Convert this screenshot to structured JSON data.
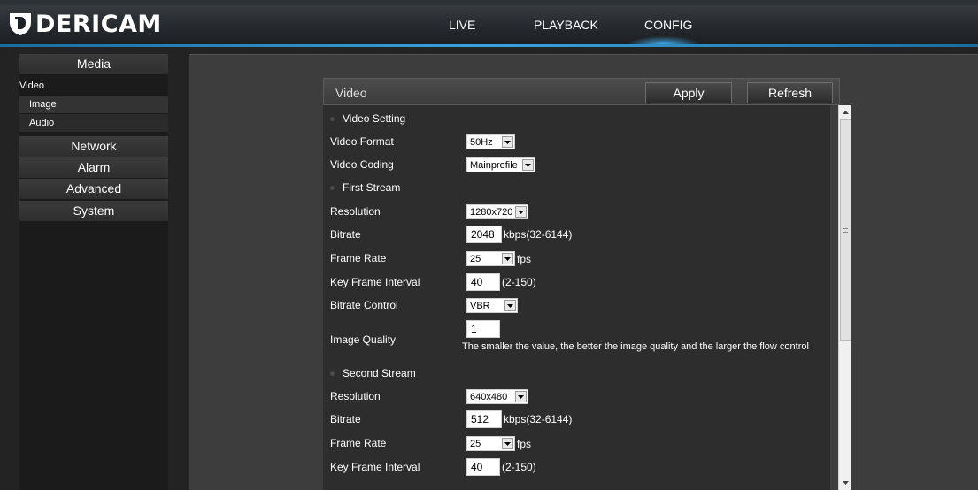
{
  "brand": {
    "name": "DERICAM"
  },
  "nav": {
    "live": "LIVE",
    "playback": "PLAYBACK",
    "config": "CONFIG"
  },
  "sidebar": {
    "media": "Media",
    "video": "Video",
    "image": "Image",
    "audio": "Audio",
    "network": "Network",
    "alarm": "Alarm",
    "advanced": "Advanced",
    "system": "System"
  },
  "panel": {
    "title": "Video",
    "apply": "Apply",
    "refresh": "Refresh"
  },
  "video_setting": {
    "section": "Video Setting",
    "format_label": "Video Format",
    "format_value": "50Hz",
    "coding_label": "Video Coding",
    "coding_value": "Mainprofile"
  },
  "first_stream": {
    "section": "First Stream",
    "resolution_label": "Resolution",
    "resolution_value": "1280x720",
    "bitrate_label": "Bitrate",
    "bitrate_value": "2048",
    "bitrate_unit": "kbps(32-6144)",
    "framerate_label": "Frame Rate",
    "framerate_value": "25",
    "framerate_unit": "fps",
    "keyframe_label": "Key Frame Interval",
    "keyframe_value": "40",
    "keyframe_unit": "(2-150)",
    "bitrate_control_label": "Bitrate Control",
    "bitrate_control_value": "VBR",
    "quality_label": "Image Quality",
    "quality_value": "1",
    "quality_hint": "The smaller the value, the better the image quality and the larger the flow control"
  },
  "second_stream": {
    "section": "Second Stream",
    "resolution_label": "Resolution",
    "resolution_value": "640x480",
    "bitrate_label": "Bitrate",
    "bitrate_value": "512",
    "bitrate_unit": "kbps(32-6144)",
    "framerate_label": "Frame Rate",
    "framerate_value": "25",
    "framerate_unit": "fps",
    "keyframe_label": "Key Frame Interval",
    "keyframe_value": "40",
    "keyframe_unit": "(2-150)"
  },
  "colors": {
    "accent": "#3aa3dd",
    "background": "#232323",
    "panel": "#2d2d2d"
  }
}
